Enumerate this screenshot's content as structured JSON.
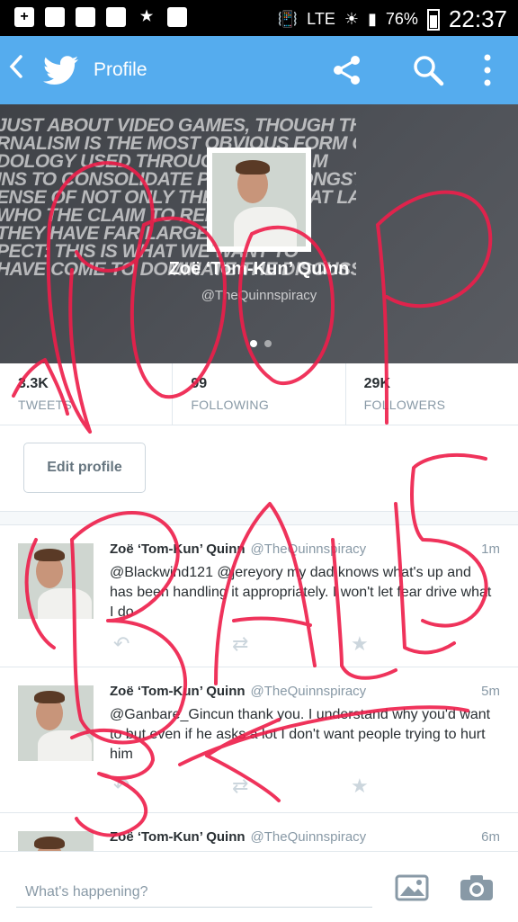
{
  "status_bar": {
    "network": "LTE",
    "battery": "76%",
    "time": "22:37"
  },
  "app_bar": {
    "title": "Profile"
  },
  "header": {
    "banner_lines": [
      "JUST ABOUT VIDEO GAMES, THOUGH THE CURRENT STATE OF VIDEO",
      "RNALISM IS THE MOST OBVIOUS FORM OF",
      "DOLOGY USED THROUGHOUT THE M",
      "INS TO CONSOLIDATE POWER AMONGST",
      "ENSE OF NOT ONLY THE CULTURE AT LA",
      "WHO THE CLAIM TO REPRESEN",
      "THEY HAVE FAR LARGER POWERS",
      "PECT: THIS IS WHAT WE WANT TO",
      "HAVE COME TO DOMINATE THE DISCUSSION TO SUCH A DEGREE"
    ],
    "name": "Zoë ‘Tom-Kun’ Quinn",
    "handle": "@TheQuinnspiracy"
  },
  "stats": [
    {
      "value": "3.3K",
      "label": "TWEETS"
    },
    {
      "value": "99",
      "label": "FOLLOWING"
    },
    {
      "value": "29K",
      "label": "FOLLOWERS"
    }
  ],
  "edit_profile_label": "Edit profile",
  "tweets": [
    {
      "name": "Zoë ‘Tom-Kun’ Quinn",
      "handle": "@TheQuinnspiracy",
      "time": "1m",
      "text": "@Blackwind121 @jereyory my dad knows what's up and has been handling it appropriately. I won't let fear drive what I do"
    },
    {
      "name": "Zoë ‘Tom-Kun’ Quinn",
      "handle": "@TheQuinnspiracy",
      "time": "5m",
      "text": "@Ganbare_Gincun thank you. I understand why you'd want to but even if he asks a lot I don't want people trying to hurt him"
    },
    {
      "name": "Zoë ‘Tom-Kun’ Quinn",
      "handle": "@TheQuinnspiracy",
      "time": "6m",
      "text": ""
    }
  ],
  "composer": {
    "placeholder": "What's happening?"
  },
  "colors": {
    "brand": "#55acee",
    "scribble": "#ee1e4a"
  },
  "icons": [
    "back-arrow-icon",
    "twitter-bird-icon",
    "share-icon",
    "search-icon",
    "more-vert-icon",
    "reply-icon",
    "retweet-icon",
    "favorite-star-icon",
    "photo-icon",
    "camera-icon"
  ]
}
